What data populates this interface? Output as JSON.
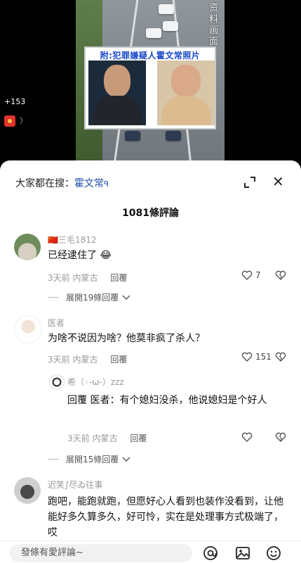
{
  "video": {
    "side_text": "资料画面",
    "photo_caption": "附:犯罪嫌疑人霍文常照片",
    "live_count": "+153",
    "chevron": "〉"
  },
  "sheet": {
    "search_label": "大家都在搜：",
    "search_keyword": "霍文常",
    "search_icon": "ᑫ",
    "comment_count_title": "1081條評論"
  },
  "comments": [
    {
      "flag": "🇨🇳",
      "username": "三毛1812",
      "text": "已经逮住了",
      "emoji": "😂",
      "time": "3天前",
      "region": "内蒙古",
      "reply_label": "回覆",
      "likes": "7",
      "expand_label": "展開19條回覆"
    },
    {
      "username": "医者",
      "text": "为啥不说因为啥？他莫非疯了杀人？",
      "time": "3天前",
      "region": "内蒙古",
      "reply_label": "回覆",
      "likes": "151"
    },
    {
      "username": "希（◦-ω-）zzz",
      "text": "回覆 医者：有个媳妇没杀，他说媳妇是个好人",
      "time": "3天前",
      "region": "内蒙古",
      "reply_label": "回覆",
      "expand_label": "展開15條回覆"
    },
    {
      "username": "迟笑∫尽ゐ往事",
      "text": "跑吧，能跑就跑，但愿好心人看到也装作没看到，让他能好多久算多久，好可怜，实在是处理事方式极端了，哎"
    }
  ],
  "bottom": {
    "input_placeholder": "發條有愛評論~"
  }
}
